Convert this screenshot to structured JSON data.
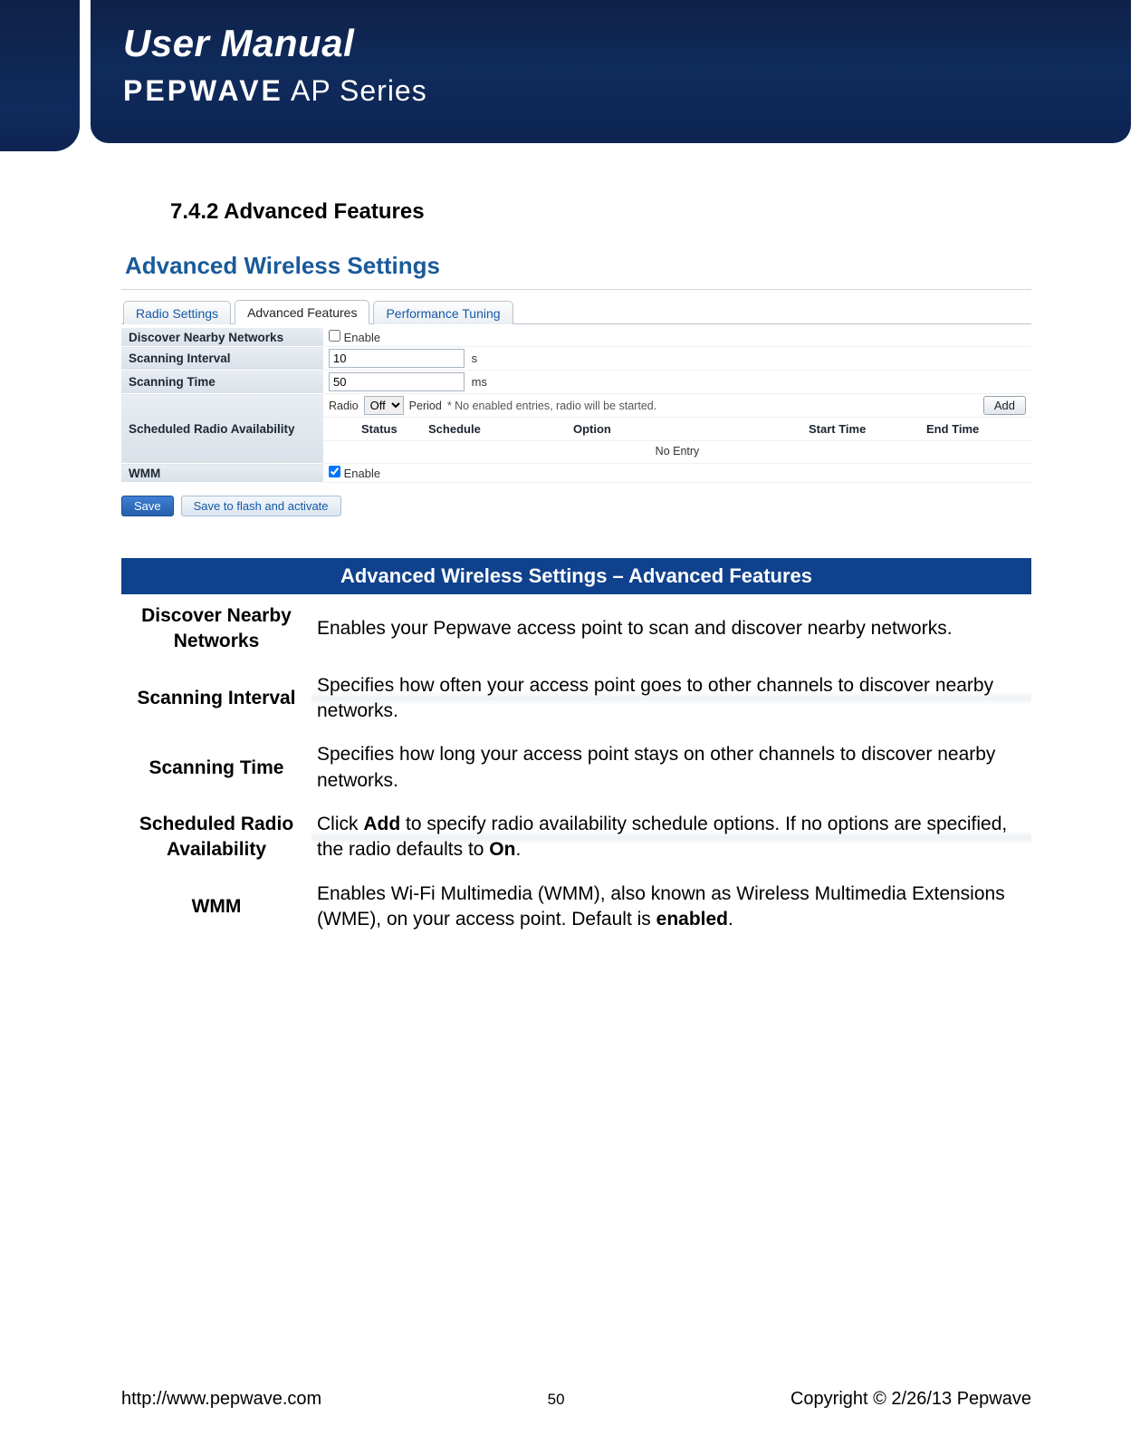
{
  "banner": {
    "title": "User Manual",
    "brand_bold": "PEPWAVE",
    "brand_light": " AP Series"
  },
  "section_heading": "7.4.2 Advanced Features",
  "screenshot": {
    "title": "Advanced Wireless Settings",
    "tabs": [
      {
        "label": "Radio Settings",
        "active": false
      },
      {
        "label": "Advanced Features",
        "active": true
      },
      {
        "label": "Performance Tuning",
        "active": false
      }
    ],
    "rows": {
      "discover_label": "Discover Nearby Networks",
      "discover_checkbox_label": "Enable",
      "discover_checked": false,
      "scan_interval_label": "Scanning Interval",
      "scan_interval_value": "10",
      "scan_interval_unit": "s",
      "scan_time_label": "Scanning Time",
      "scan_time_value": "50",
      "scan_time_unit": "ms",
      "sched_label": "Scheduled Radio Availability",
      "sched_radio_word": "Radio",
      "sched_radio_select": "Off",
      "sched_period_word": "Period",
      "sched_note": "* No enabled entries, radio will be started.",
      "sched_add": "Add",
      "sched_headers": [
        "Status",
        "Schedule",
        "Option",
        "Start Time",
        "End Time"
      ],
      "sched_no_entry": "No Entry",
      "wmm_label": "WMM",
      "wmm_checkbox_label": "Enable",
      "wmm_checked": true
    },
    "buttons": {
      "save": "Save",
      "save_flash": "Save to flash and activate"
    }
  },
  "desc": {
    "header": "Advanced Wireless Settings – Advanced Features",
    "rows": [
      {
        "term": "Discover Nearby Networks",
        "def_parts": [
          "Enables your Pepwave access point to scan and discover nearby networks."
        ]
      },
      {
        "term": "Scanning Interval",
        "def_parts": [
          "Specifies how often your access point goes to other channels to discover nearby networks."
        ]
      },
      {
        "term": "Scanning Time",
        "def_parts": [
          "Specifies how long your access point stays on other channels to discover nearby networks."
        ]
      },
      {
        "term": "Scheduled Radio Availability",
        "def_parts": [
          "Click ",
          "Add",
          " to specify radio availability schedule options. If no options are specified, the radio defaults to ",
          "On",
          "."
        ]
      },
      {
        "term": "WMM",
        "def_parts": [
          "Enables Wi-Fi Multimedia (WMM), also known as Wireless Multimedia Extensions (WME), on your access point. Default is ",
          "enabled",
          "."
        ]
      }
    ]
  },
  "footer": {
    "url": "http://www.pepwave.com",
    "page": "50",
    "copyright": "Copyright © 2/26/13 Pepwave"
  }
}
